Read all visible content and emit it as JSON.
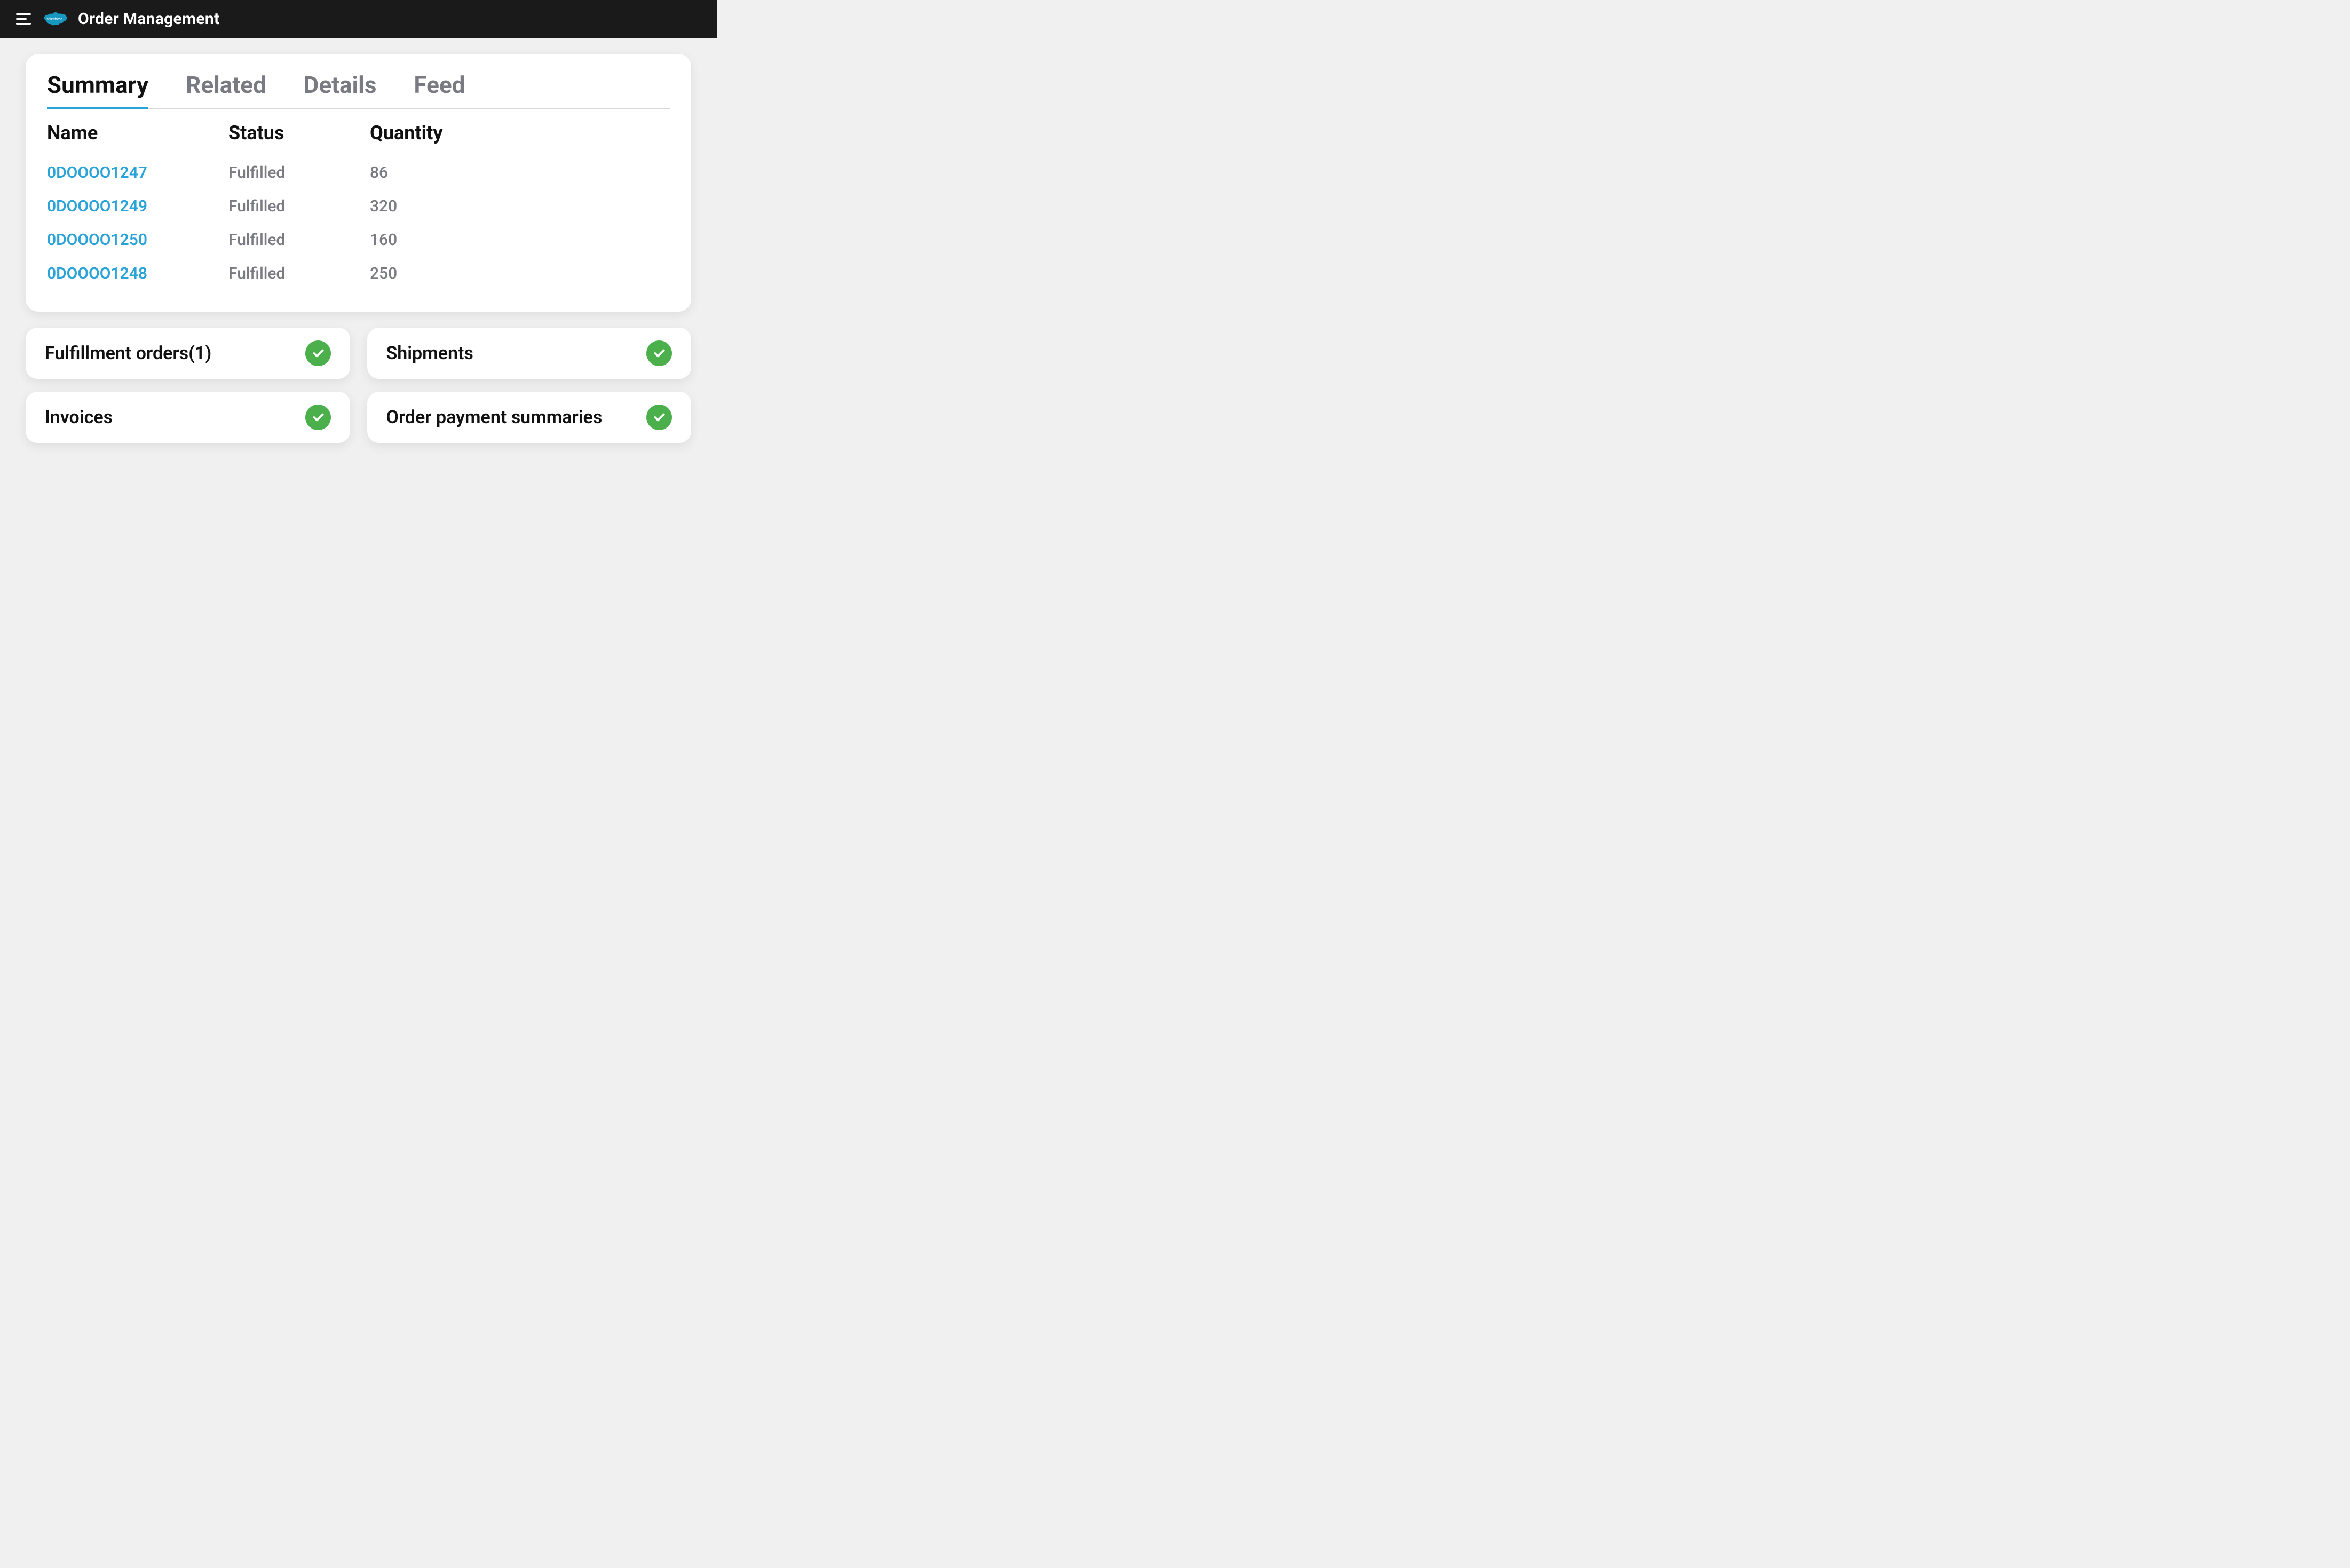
{
  "header": {
    "title": "Order Management",
    "logo_text": "salesforce"
  },
  "tabs": [
    {
      "label": "Summary",
      "active": true
    },
    {
      "label": "Related",
      "active": false
    },
    {
      "label": "Details",
      "active": false
    },
    {
      "label": "Feed",
      "active": false
    }
  ],
  "table": {
    "columns": [
      "Name",
      "Status",
      "Quantity"
    ],
    "rows": [
      {
        "name": "0DOOOO1247",
        "status": "Fulfilled",
        "quantity": "86"
      },
      {
        "name": "0DOOOO1249",
        "status": "Fulfilled",
        "quantity": "320"
      },
      {
        "name": "0DOOOO1250",
        "status": "Fulfilled",
        "quantity": "160"
      },
      {
        "name": "0DOOOO1248",
        "status": "Fulfilled",
        "quantity": "250"
      }
    ]
  },
  "tiles": [
    {
      "label": "Fulfillment orders(1)"
    },
    {
      "label": "Shipments"
    },
    {
      "label": "Invoices"
    },
    {
      "label": "Order payment summaries"
    }
  ]
}
